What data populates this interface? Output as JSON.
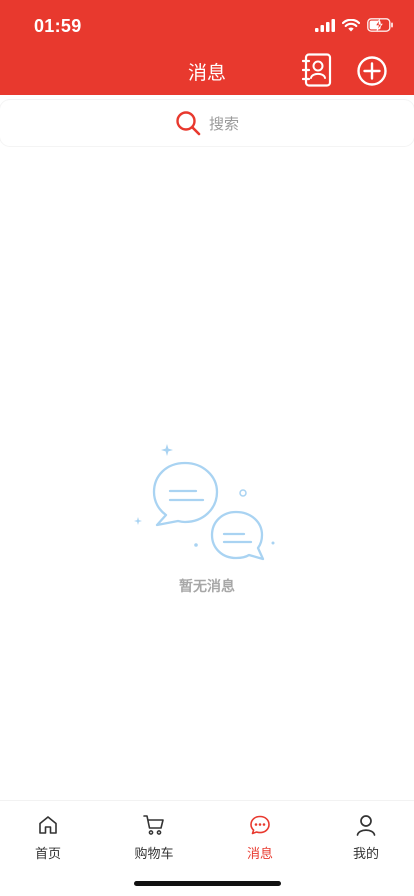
{
  "status_bar": {
    "time": "01:59"
  },
  "header": {
    "title": "消息",
    "background_color": "#e8392e",
    "contacts_icon": "contacts-book-icon",
    "add_icon": "plus-circle-icon"
  },
  "search": {
    "placeholder": "搜索",
    "icon": "search-icon"
  },
  "empty_state": {
    "text": "暂无消息",
    "icon": "chat-bubbles-icon"
  },
  "tabs": [
    {
      "label": "首页",
      "icon": "home-icon",
      "active": false
    },
    {
      "label": "购物车",
      "icon": "cart-icon",
      "active": false
    },
    {
      "label": "消息",
      "icon": "message-icon",
      "active": true
    },
    {
      "label": "我的",
      "icon": "user-icon",
      "active": false
    }
  ],
  "colors": {
    "accent": "#e8392e",
    "empty_icon": "#a9d3f2"
  }
}
